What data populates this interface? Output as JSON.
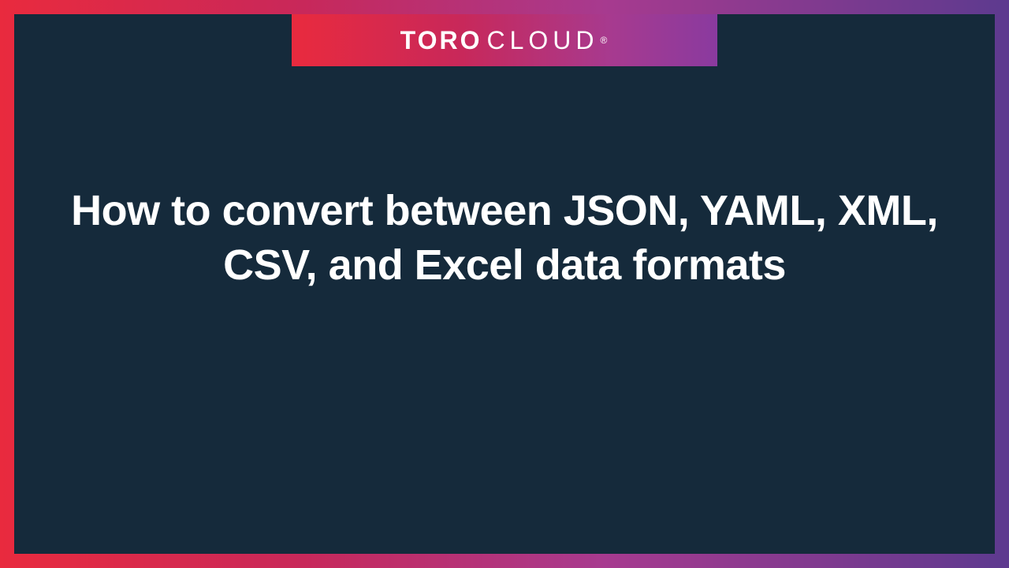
{
  "logo": {
    "toro": "TORO",
    "cloud": "CLOUD",
    "reg": "®"
  },
  "title": "How to convert between JSON, YAML, XML, CSV, and Excel data formats"
}
